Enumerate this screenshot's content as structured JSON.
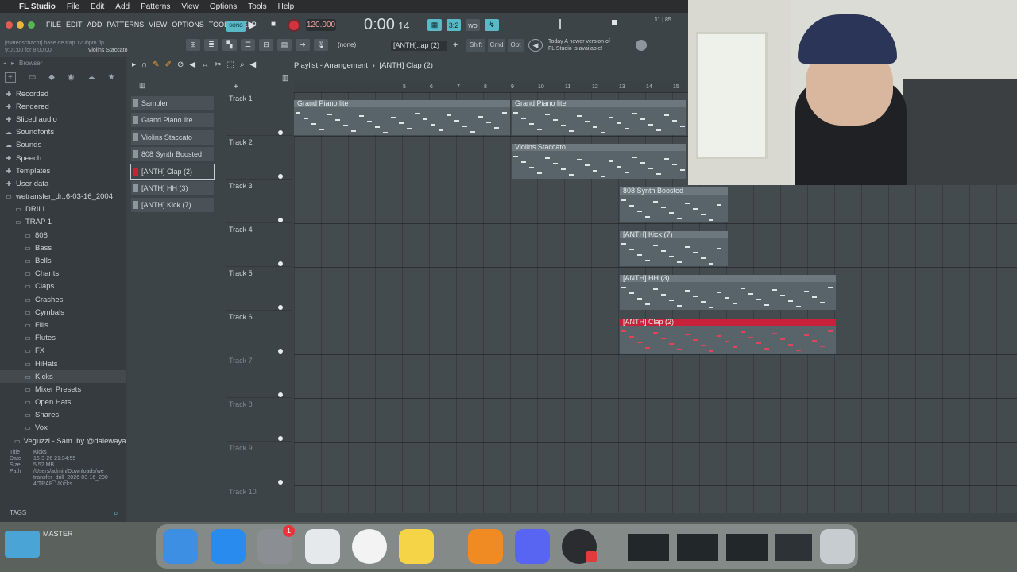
{
  "mac_menu": {
    "apple": "",
    "app": "FL Studio",
    "items": [
      "File",
      "Edit",
      "Add",
      "Patterns",
      "View",
      "Options",
      "Tools",
      "Help"
    ]
  },
  "fl_menu": [
    "FILE",
    "EDIT",
    "ADD",
    "PATTERNS",
    "VIEW",
    "OPTIONS",
    "TOOLS",
    "HELP"
  ],
  "project": {
    "file": "[mateoschacht] base de trap 120bpm.flp",
    "time": "9:01:00 for 8:00:00",
    "hint_instrument": "Violins Staccato"
  },
  "transport": {
    "song_label": "SONG",
    "tempo": "120.000",
    "time": "0:00",
    "time_small": "14",
    "pattern": "(none)",
    "pattern_box": "[ANTH]..ap (2)",
    "shift": "Shift",
    "cmd": "Cmd",
    "opt": "Opt"
  },
  "update_hint": {
    "line1": "Today  A newer version of",
    "line2": "FL Studio is available!"
  },
  "browser": {
    "label": "Browser",
    "items": [
      {
        "label": "Recorded",
        "icon": "plus-icon",
        "indent": 1
      },
      {
        "label": "Rendered",
        "icon": "plus-icon",
        "indent": 1
      },
      {
        "label": "Sliced audio",
        "icon": "plus-icon",
        "indent": 1
      },
      {
        "label": "Soundfonts",
        "icon": "cloud-icon",
        "indent": 1
      },
      {
        "label": "Sounds",
        "icon": "cloud-icon",
        "indent": 1
      },
      {
        "label": "Speech",
        "icon": "plus-icon",
        "indent": 1
      },
      {
        "label": "Templates",
        "icon": "plus-icon",
        "indent": 1
      },
      {
        "label": "User data",
        "icon": "user-icon",
        "indent": 1
      },
      {
        "label": "wetransfer_dr..6-03-16_2004",
        "icon": "folder-icon",
        "indent": 1
      },
      {
        "label": "DRILL",
        "icon": "folder-icon",
        "indent": 2
      },
      {
        "label": "TRAP 1",
        "icon": "folder-icon",
        "indent": 2
      },
      {
        "label": "808",
        "icon": "folder-icon",
        "indent": 3
      },
      {
        "label": "Bass",
        "icon": "folder-icon",
        "indent": 3
      },
      {
        "label": "Bells",
        "icon": "folder-icon",
        "indent": 3
      },
      {
        "label": "Chants",
        "icon": "folder-icon",
        "indent": 3
      },
      {
        "label": "Claps",
        "icon": "folder-icon",
        "indent": 3
      },
      {
        "label": "Crashes",
        "icon": "folder-icon",
        "indent": 3
      },
      {
        "label": "Cymbals",
        "icon": "folder-icon",
        "indent": 3
      },
      {
        "label": "Fills",
        "icon": "folder-icon",
        "indent": 3
      },
      {
        "label": "Flutes",
        "icon": "folder-icon",
        "indent": 3
      },
      {
        "label": "FX",
        "icon": "folder-icon",
        "indent": 3
      },
      {
        "label": "HiHats",
        "icon": "folder-icon",
        "indent": 3
      },
      {
        "label": "Kicks",
        "icon": "folder-icon",
        "indent": 3,
        "selected": true
      },
      {
        "label": "Mixer Presets",
        "icon": "folder-icon",
        "indent": 3
      },
      {
        "label": "Open Hats",
        "icon": "folder-icon",
        "indent": 3
      },
      {
        "label": "Snares",
        "icon": "folder-icon",
        "indent": 3
      },
      {
        "label": "Vox",
        "icon": "folder-icon",
        "indent": 3
      },
      {
        "label": "Veguzzi - Sam..by @dalewaya",
        "icon": "folder-icon",
        "indent": 2
      }
    ],
    "info": {
      "title_k": "Title",
      "title_v": "Kicks",
      "date_k": "Date",
      "date_v": "16-3-26 21:34:55",
      "size_k": "Size",
      "size_v": "5.52 MB",
      "path_k": "Path",
      "path_v1": "/Users/admin/Downloads/we",
      "path_v2": "transfer_drill_2026-03-16_200",
      "path_v3": "4/TRAP 1/Kicks"
    },
    "tags": "TAGS"
  },
  "playlist": {
    "title": "Playlist - Arrangement",
    "pattern": "[ANTH] Clap (2)"
  },
  "channels": [
    "Sampler",
    "Grand Piano lite",
    "Violins Staccato",
    "808 Synth Boosted",
    "[ANTH] Clap (2)",
    "[ANTH] HH (3)",
    "[ANTH] Kick (7)"
  ],
  "tracks": [
    "Track 1",
    "Track 2",
    "Track 3",
    "Track 4",
    "Track 5",
    "Track 6",
    "Track 7",
    "Track 8",
    "Track 9",
    "Track 10"
  ],
  "ruler": [
    "5",
    "6",
    "7",
    "8",
    "9",
    "10",
    "11",
    "12",
    "13",
    "14",
    "15"
  ],
  "clips": [
    {
      "label": "Grand Piano lite",
      "track": 1
    },
    {
      "label": "Grand Piano lite",
      "track": 1
    },
    {
      "label": "Violins Staccato",
      "track": 2
    },
    {
      "label": "808 Synth Boosted",
      "track": 3
    },
    {
      "label": "[ANTH] Kick (7)",
      "track": 4
    },
    {
      "label": "[ANTH] HH (3)",
      "track": 5
    },
    {
      "label": "[ANTH] Clap (2)",
      "track": 6
    }
  ],
  "dock": {
    "label": "MASTER"
  },
  "colors": {
    "accent": "#5ab9c7",
    "clip_red": "#c8213a"
  }
}
